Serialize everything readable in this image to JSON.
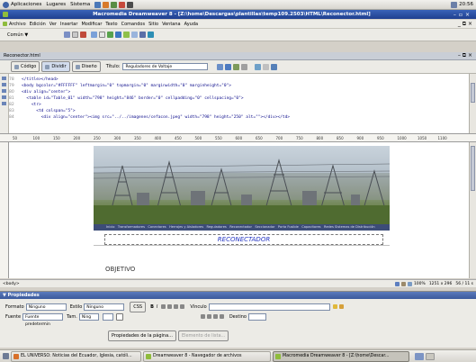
{
  "top_panel": {
    "menus": [
      "Aplicaciones",
      "Lugares",
      "Sistema"
    ],
    "clock": "20:56"
  },
  "window": {
    "title": "Macromedia Dreamweaver 8 - [Z:\\home\\Descargas\\plantillas\\temp109.2503\\HTML\\Reconector.html]",
    "menubar": [
      "Archivo",
      "Edición",
      "Ver",
      "Insertar",
      "Modificar",
      "Texto",
      "Comandos",
      "Sitio",
      "Ventana",
      "Ayuda"
    ],
    "insert_bar_label": "Común ▼"
  },
  "document": {
    "tab_label": "Reconector.html",
    "view_buttons": [
      "Código",
      "Dividir",
      "Diseño"
    ],
    "title_label": "Título:",
    "title_value": "Reguladores de Voltaje",
    "code_lines": [
      {
        "n": "78",
        "code": "</title></head>"
      },
      {
        "n": "79",
        "code": "<body bgcolor=\"#FFFFFF\" leftmargin=\"0\" topmargin=\"0\" marginwidth=\"0\" marginheight=\"0\">"
      },
      {
        "n": "80",
        "code": "<div align=\"center\">"
      },
      {
        "n": "81",
        "code": "  <table id=\"Table_01\" width=\"798\" height=\"846\" border=\"0\" cellpadding=\"0\" cellspacing=\"0\">"
      },
      {
        "n": "82",
        "code": "    <tr>"
      },
      {
        "n": "83",
        "code": "      <td colspan=\"5\">"
      },
      {
        "n": "84",
        "code": "        <div align=\"center\"><img src=\"../../imagenes/cefacon.jpeg\" width=\"798\" height=\"250\" alt=\"\"></div></td>"
      }
    ],
    "ruler_ticks": [
      "50",
      "100",
      "150",
      "200",
      "250",
      "300",
      "350",
      "400",
      "450",
      "500",
      "550",
      "600",
      "650",
      "700",
      "750",
      "800",
      "850",
      "900",
      "950",
      "1000",
      "1050",
      "1100"
    ],
    "nav_links": "Inicio   Transformadores   Conectores   Herrajes y Aisladores   Reguladores   Reconectador   Seccionador   Porta Fusible   Capacitores   Redes Sistemas de Distribución",
    "page_heading": "RECONECTADOR",
    "section_label": "OBJETIVO"
  },
  "status": {
    "tag": "<body>",
    "zoom": "100%",
    "size": "1251 x 296",
    "weight": "56 / 11 s"
  },
  "properties": {
    "panel_title": "▼ Propiedades",
    "formato_label": "Formato",
    "formato_value": "Ninguno",
    "estilo_label": "Estilo",
    "estilo_value": "Ninguno",
    "css_label": "CSS",
    "fuente_label": "Fuente",
    "fuente_value": "Fuente predetermin",
    "tam_label": "Tam.",
    "tam_value": "Ning",
    "vinculo_label": "Vínculo",
    "destino_label": "Destino",
    "page_props_button": "Propiedades de la página...",
    "list_item_button": "Elemento de lista..."
  },
  "taskbar": {
    "items": [
      {
        "label": "EL UNIVERSO: Noticias del Ecuador, Iglesia, católi...",
        "active": false
      },
      {
        "label": "Dreamweaver 8 - Navegador de archivos",
        "active": false
      },
      {
        "label": "Macromedia Dreamweaver 8 - [Z:\\home\\Descar...",
        "active": true
      }
    ]
  },
  "colors": {
    "title_bar": "#1f3f8f",
    "nav_bar": "#3c4c77",
    "heading_blue": "#2334c2"
  }
}
